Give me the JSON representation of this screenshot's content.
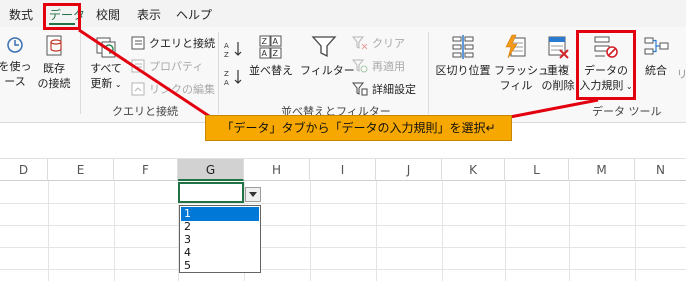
{
  "tabs": [
    {
      "label": "数式"
    },
    {
      "label": "データ"
    },
    {
      "label": "校閲"
    },
    {
      "label": "表示"
    },
    {
      "label": "ヘルプ"
    }
  ],
  "ribbon": {
    "get_data": {
      "line1": "を使っ",
      "line2": "ース"
    },
    "existing_conn": {
      "line1": "既存",
      "line2": "の接続"
    },
    "refresh_all": {
      "line1": "すべて",
      "line2": "更新"
    },
    "queries_connections": "クエリと接続",
    "properties": "プロパティ",
    "edit_links": "リンクの編集",
    "group_queries": "クエリと接続",
    "sort_az": "A→Z",
    "sort_za": "Z→A",
    "sort": "並べ替え",
    "filter": "フィルター",
    "clear": "クリア",
    "reapply": "再適用",
    "advanced": "詳細設定",
    "group_sort": "並べ替えとフィルター",
    "text_to_columns": "区切り位置",
    "flash_fill": {
      "line1": "フラッシュ",
      "line2": "フィル"
    },
    "remove_duplicates": {
      "line1": "重複",
      "line2": "の削除"
    },
    "data_validation": {
      "line1": "データの",
      "line2": "入力規則"
    },
    "group_data_tools": "データ ツール",
    "consolidate": "統合",
    "truncated_next": "リ"
  },
  "grid": {
    "columns": [
      "D",
      "E",
      "F",
      "G",
      "H",
      "I",
      "J",
      "K",
      "L",
      "M",
      "N"
    ],
    "selected_column": "G"
  },
  "dropdown": {
    "options": [
      "1",
      "2",
      "3",
      "4",
      "5"
    ],
    "selected_index": 0
  },
  "annotation": {
    "text": "「データ」タブから「データの入力規則」を選択↵"
  },
  "colors": {
    "accent": "#217346",
    "highlight_red": "#e3000f",
    "callout_fill": "#f7a800",
    "selection_blue": "#0078d7"
  }
}
